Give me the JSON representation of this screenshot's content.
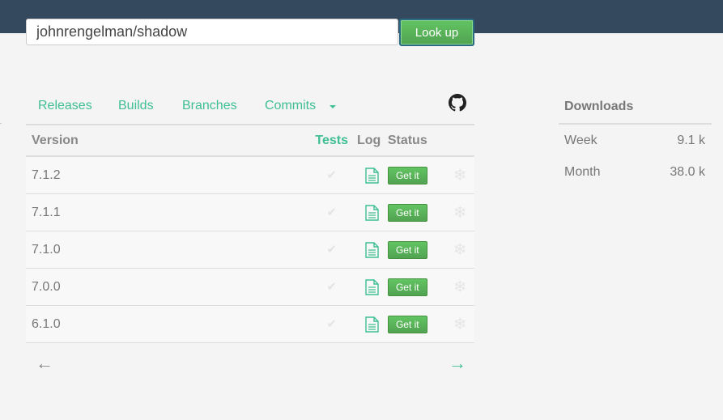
{
  "search": {
    "value": "johnrengelman/shadow",
    "button_label": "Look up"
  },
  "tabs": [
    {
      "label": "Releases"
    },
    {
      "label": "Builds"
    },
    {
      "label": "Branches"
    },
    {
      "label": "Commits"
    }
  ],
  "table": {
    "headers": {
      "version": "Version",
      "tests": "Tests",
      "log": "Log",
      "status": "Status"
    },
    "rows": [
      {
        "version": "7.1.2",
        "action": "Get it"
      },
      {
        "version": "7.1.1",
        "action": "Get it"
      },
      {
        "version": "7.1.0",
        "action": "Get it"
      },
      {
        "version": "7.0.0",
        "action": "Get it"
      },
      {
        "version": "6.1.0",
        "action": "Get it"
      }
    ],
    "check_glyph": "✔",
    "snow_glyph": "❄"
  },
  "pager": {
    "prev": "←",
    "next": "→"
  },
  "downloads": {
    "title": "Downloads",
    "rows": [
      {
        "label": "Week",
        "value": "9.1 k"
      },
      {
        "label": "Month",
        "value": "38.0 k"
      }
    ]
  },
  "colors": {
    "topbar": "#34495e",
    "accent": "#3fbf92",
    "button": "#5cb85c"
  },
  "icons": {
    "repo": "github-icon",
    "log": "document-icon",
    "test": "check-icon",
    "status": "snowflake-icon",
    "more": "caret-down-icon"
  }
}
